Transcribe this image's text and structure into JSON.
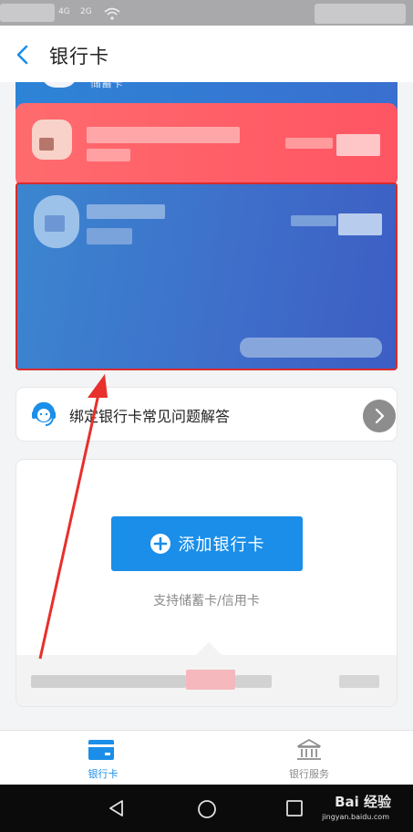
{
  "status_bar": {
    "signal_1": "4G",
    "signal_2": "2G"
  },
  "nav": {
    "title": "银行卡"
  },
  "cards": {
    "top_card_fragment": "储蓄卡"
  },
  "faq": {
    "label": "绑定银行卡常见问题解答"
  },
  "add_card": {
    "button_label": "添加银行卡",
    "hint": "支持储蓄卡/信用卡"
  },
  "tabbar": {
    "tabs": [
      {
        "label": "银行卡",
        "icon": "bank-card-icon",
        "active": true
      },
      {
        "label": "银行服务",
        "icon": "bank-building-icon",
        "active": false
      }
    ]
  },
  "watermark": {
    "brand": "Bai 经验",
    "url": "jingyan.baidu.com"
  },
  "colors": {
    "accent": "#1a8ee8",
    "red_card": "#ff5f66",
    "blue_card": "#3e6dca",
    "annotation": "#e8302c"
  }
}
